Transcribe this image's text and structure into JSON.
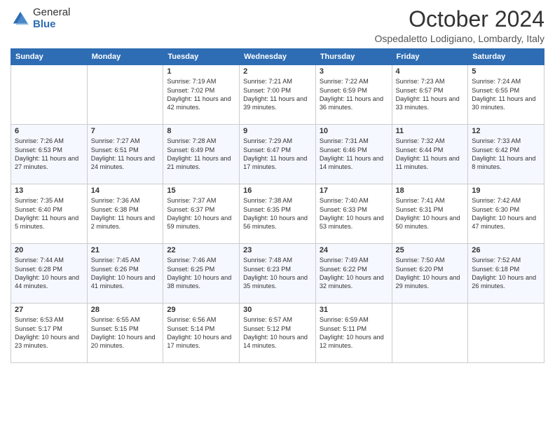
{
  "header": {
    "logo_general": "General",
    "logo_blue": "Blue",
    "month_title": "October 2024",
    "location": "Ospedaletto Lodigiano, Lombardy, Italy"
  },
  "weekdays": [
    "Sunday",
    "Monday",
    "Tuesday",
    "Wednesday",
    "Thursday",
    "Friday",
    "Saturday"
  ],
  "weeks": [
    [
      {
        "day": "",
        "sunrise": "",
        "sunset": "",
        "daylight": ""
      },
      {
        "day": "",
        "sunrise": "",
        "sunset": "",
        "daylight": ""
      },
      {
        "day": "1",
        "sunrise": "Sunrise: 7:19 AM",
        "sunset": "Sunset: 7:02 PM",
        "daylight": "Daylight: 11 hours and 42 minutes."
      },
      {
        "day": "2",
        "sunrise": "Sunrise: 7:21 AM",
        "sunset": "Sunset: 7:00 PM",
        "daylight": "Daylight: 11 hours and 39 minutes."
      },
      {
        "day": "3",
        "sunrise": "Sunrise: 7:22 AM",
        "sunset": "Sunset: 6:59 PM",
        "daylight": "Daylight: 11 hours and 36 minutes."
      },
      {
        "day": "4",
        "sunrise": "Sunrise: 7:23 AM",
        "sunset": "Sunset: 6:57 PM",
        "daylight": "Daylight: 11 hours and 33 minutes."
      },
      {
        "day": "5",
        "sunrise": "Sunrise: 7:24 AM",
        "sunset": "Sunset: 6:55 PM",
        "daylight": "Daylight: 11 hours and 30 minutes."
      }
    ],
    [
      {
        "day": "6",
        "sunrise": "Sunrise: 7:26 AM",
        "sunset": "Sunset: 6:53 PM",
        "daylight": "Daylight: 11 hours and 27 minutes."
      },
      {
        "day": "7",
        "sunrise": "Sunrise: 7:27 AM",
        "sunset": "Sunset: 6:51 PM",
        "daylight": "Daylight: 11 hours and 24 minutes."
      },
      {
        "day": "8",
        "sunrise": "Sunrise: 7:28 AM",
        "sunset": "Sunset: 6:49 PM",
        "daylight": "Daylight: 11 hours and 21 minutes."
      },
      {
        "day": "9",
        "sunrise": "Sunrise: 7:29 AM",
        "sunset": "Sunset: 6:47 PM",
        "daylight": "Daylight: 11 hours and 17 minutes."
      },
      {
        "day": "10",
        "sunrise": "Sunrise: 7:31 AM",
        "sunset": "Sunset: 6:46 PM",
        "daylight": "Daylight: 11 hours and 14 minutes."
      },
      {
        "day": "11",
        "sunrise": "Sunrise: 7:32 AM",
        "sunset": "Sunset: 6:44 PM",
        "daylight": "Daylight: 11 hours and 11 minutes."
      },
      {
        "day": "12",
        "sunrise": "Sunrise: 7:33 AM",
        "sunset": "Sunset: 6:42 PM",
        "daylight": "Daylight: 11 hours and 8 minutes."
      }
    ],
    [
      {
        "day": "13",
        "sunrise": "Sunrise: 7:35 AM",
        "sunset": "Sunset: 6:40 PM",
        "daylight": "Daylight: 11 hours and 5 minutes."
      },
      {
        "day": "14",
        "sunrise": "Sunrise: 7:36 AM",
        "sunset": "Sunset: 6:38 PM",
        "daylight": "Daylight: 11 hours and 2 minutes."
      },
      {
        "day": "15",
        "sunrise": "Sunrise: 7:37 AM",
        "sunset": "Sunset: 6:37 PM",
        "daylight": "Daylight: 10 hours and 59 minutes."
      },
      {
        "day": "16",
        "sunrise": "Sunrise: 7:38 AM",
        "sunset": "Sunset: 6:35 PM",
        "daylight": "Daylight: 10 hours and 56 minutes."
      },
      {
        "day": "17",
        "sunrise": "Sunrise: 7:40 AM",
        "sunset": "Sunset: 6:33 PM",
        "daylight": "Daylight: 10 hours and 53 minutes."
      },
      {
        "day": "18",
        "sunrise": "Sunrise: 7:41 AM",
        "sunset": "Sunset: 6:31 PM",
        "daylight": "Daylight: 10 hours and 50 minutes."
      },
      {
        "day": "19",
        "sunrise": "Sunrise: 7:42 AM",
        "sunset": "Sunset: 6:30 PM",
        "daylight": "Daylight: 10 hours and 47 minutes."
      }
    ],
    [
      {
        "day": "20",
        "sunrise": "Sunrise: 7:44 AM",
        "sunset": "Sunset: 6:28 PM",
        "daylight": "Daylight: 10 hours and 44 minutes."
      },
      {
        "day": "21",
        "sunrise": "Sunrise: 7:45 AM",
        "sunset": "Sunset: 6:26 PM",
        "daylight": "Daylight: 10 hours and 41 minutes."
      },
      {
        "day": "22",
        "sunrise": "Sunrise: 7:46 AM",
        "sunset": "Sunset: 6:25 PM",
        "daylight": "Daylight: 10 hours and 38 minutes."
      },
      {
        "day": "23",
        "sunrise": "Sunrise: 7:48 AM",
        "sunset": "Sunset: 6:23 PM",
        "daylight": "Daylight: 10 hours and 35 minutes."
      },
      {
        "day": "24",
        "sunrise": "Sunrise: 7:49 AM",
        "sunset": "Sunset: 6:22 PM",
        "daylight": "Daylight: 10 hours and 32 minutes."
      },
      {
        "day": "25",
        "sunrise": "Sunrise: 7:50 AM",
        "sunset": "Sunset: 6:20 PM",
        "daylight": "Daylight: 10 hours and 29 minutes."
      },
      {
        "day": "26",
        "sunrise": "Sunrise: 7:52 AM",
        "sunset": "Sunset: 6:18 PM",
        "daylight": "Daylight: 10 hours and 26 minutes."
      }
    ],
    [
      {
        "day": "27",
        "sunrise": "Sunrise: 6:53 AM",
        "sunset": "Sunset: 5:17 PM",
        "daylight": "Daylight: 10 hours and 23 minutes."
      },
      {
        "day": "28",
        "sunrise": "Sunrise: 6:55 AM",
        "sunset": "Sunset: 5:15 PM",
        "daylight": "Daylight: 10 hours and 20 minutes."
      },
      {
        "day": "29",
        "sunrise": "Sunrise: 6:56 AM",
        "sunset": "Sunset: 5:14 PM",
        "daylight": "Daylight: 10 hours and 17 minutes."
      },
      {
        "day": "30",
        "sunrise": "Sunrise: 6:57 AM",
        "sunset": "Sunset: 5:12 PM",
        "daylight": "Daylight: 10 hours and 14 minutes."
      },
      {
        "day": "31",
        "sunrise": "Sunrise: 6:59 AM",
        "sunset": "Sunset: 5:11 PM",
        "daylight": "Daylight: 10 hours and 12 minutes."
      },
      {
        "day": "",
        "sunrise": "",
        "sunset": "",
        "daylight": ""
      },
      {
        "day": "",
        "sunrise": "",
        "sunset": "",
        "daylight": ""
      }
    ]
  ]
}
